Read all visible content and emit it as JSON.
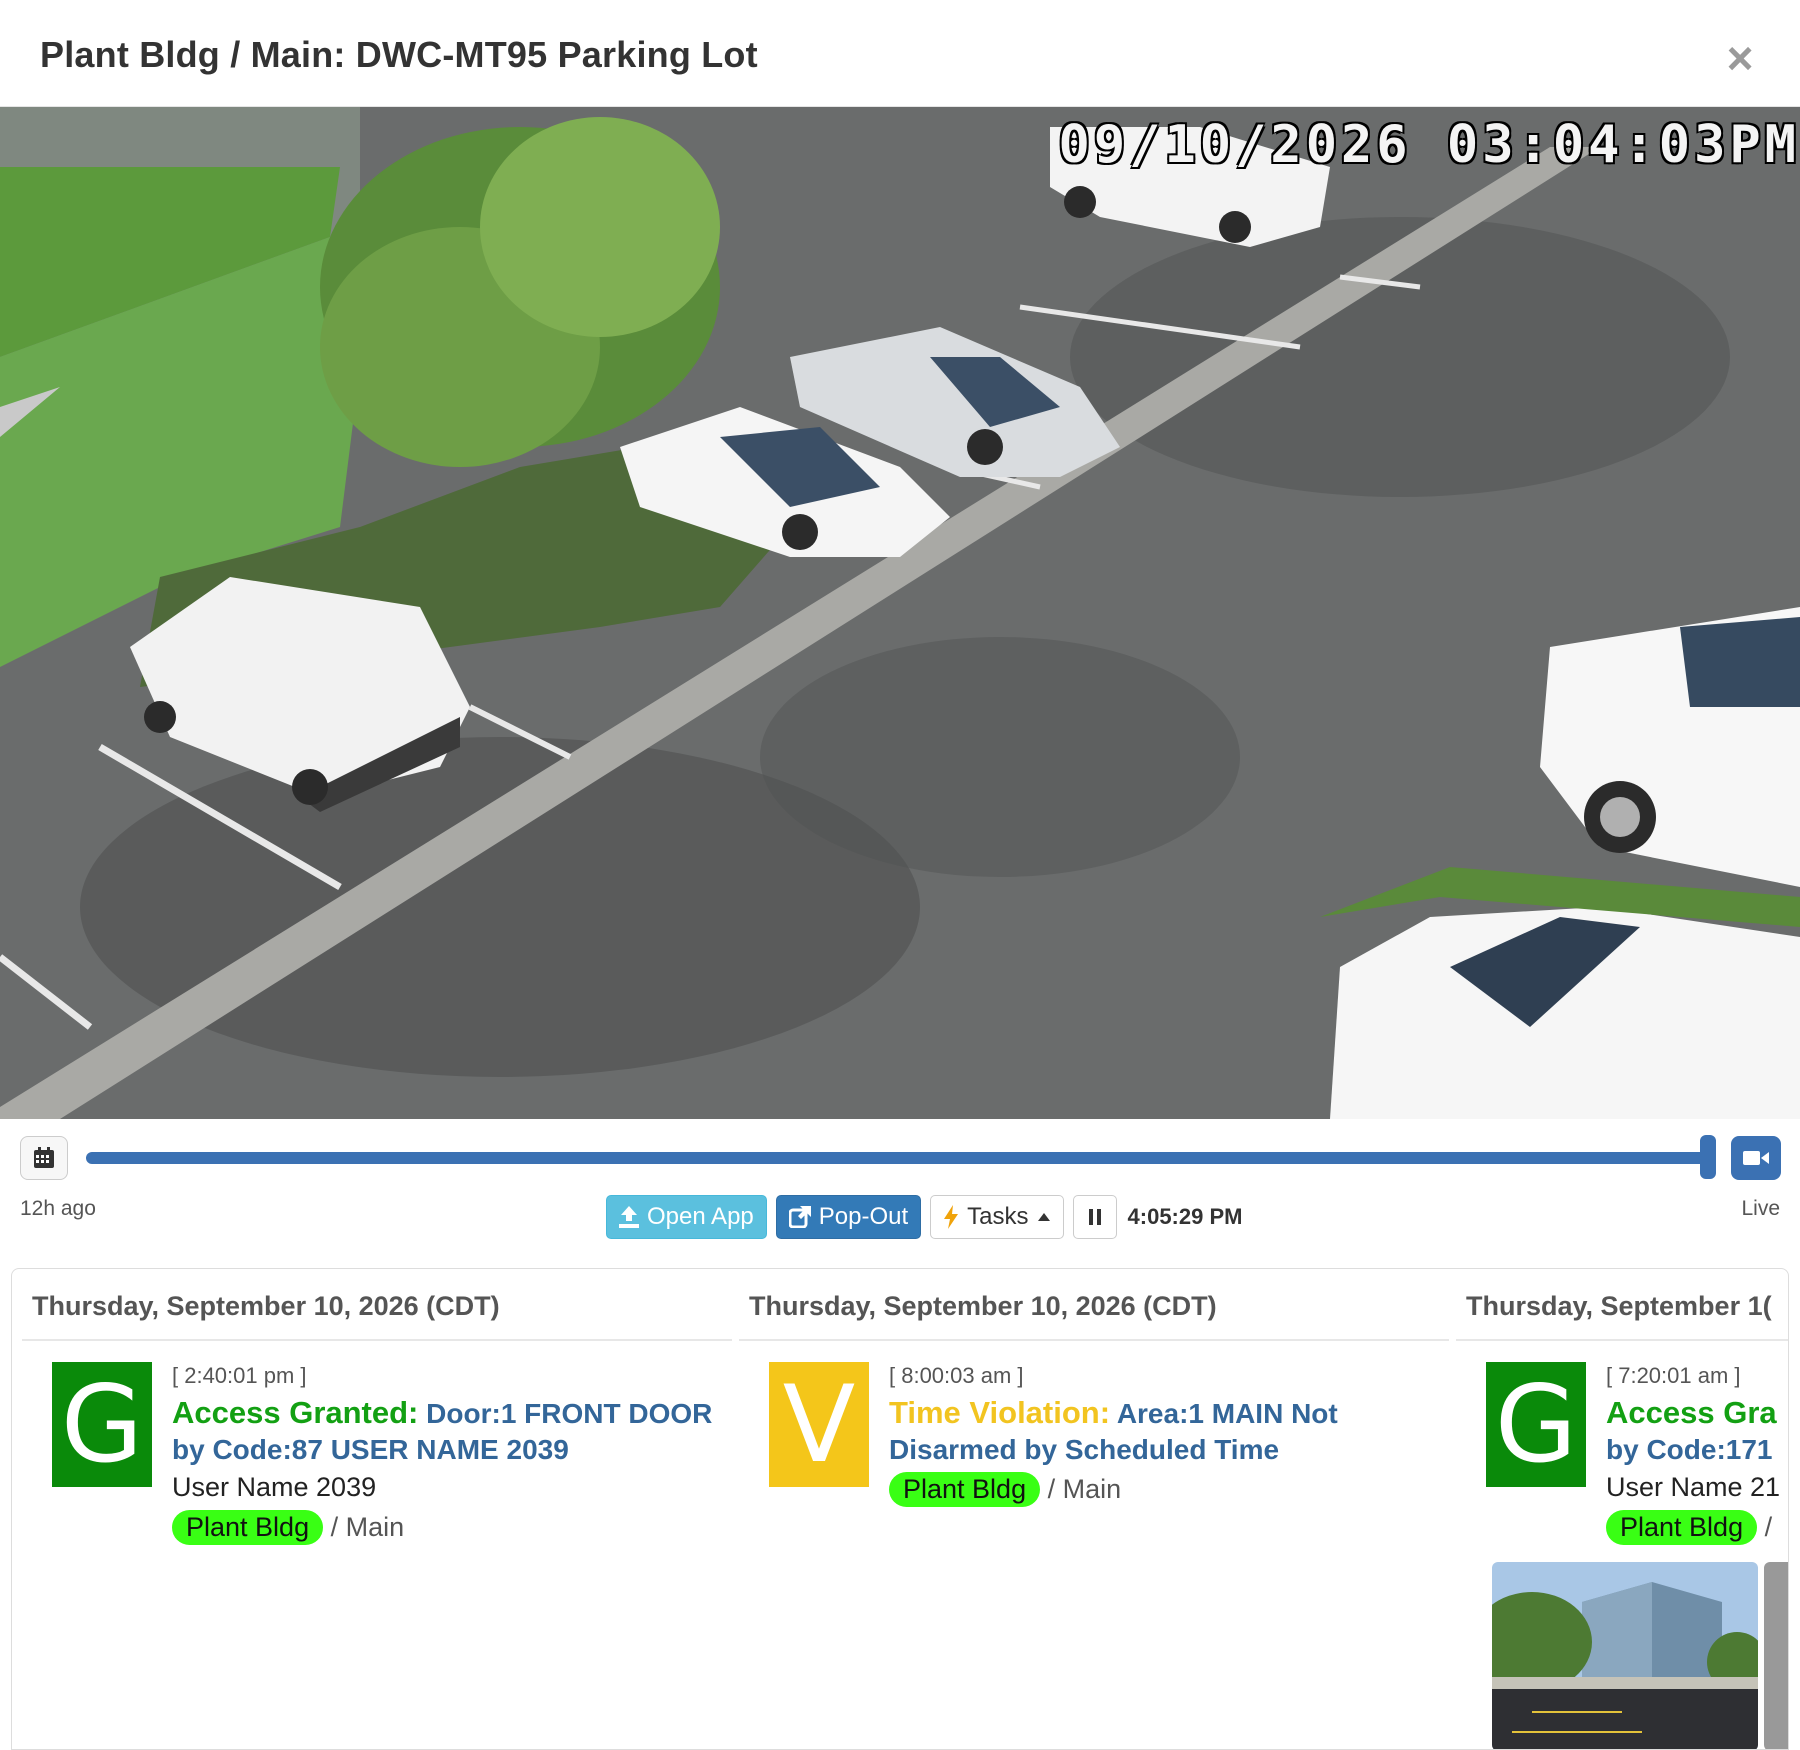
{
  "modal": {
    "title": "Plant Bldg / Main: DWC-MT95 Parking Lot",
    "close_glyph": "×"
  },
  "video": {
    "overlay_timestamp": "09/10/2026 03:04:03PM"
  },
  "timeline": {
    "start_label": "12h ago",
    "end_label": "Live",
    "position_fraction": 1.0,
    "calendar_icon": "calendar-icon",
    "live_icon": "video-camera-icon"
  },
  "toolbar": {
    "open_app": "Open App",
    "pop_out": "Pop-Out",
    "tasks": "Tasks",
    "clock": "4:05:29 PM"
  },
  "events": [
    {
      "day": "Thursday, September 10, 2026 (CDT)",
      "badge": "G",
      "badge_color": "#0a8a0a",
      "time": "[ 2:40:01 pm ]",
      "type": "Access Granted:",
      "detail": "Door:1 FRONT DOOR by Code:87 USER NAME 2039",
      "user": "User Name 2039",
      "site": "Plant Bldg",
      "area": "/ Main"
    },
    {
      "day": "Thursday, September 10, 2026 (CDT)",
      "badge": "V",
      "badge_color": "#f4c61a",
      "time": "[ 8:00:03 am ]",
      "type": "Time Violation:",
      "detail": "Area:1 MAIN Not Disarmed by Scheduled Time",
      "site": "Plant Bldg",
      "area": "/ Main"
    },
    {
      "day": "Thursday, September 1(",
      "badge": "G",
      "badge_color": "#0a8a0a",
      "time": "[ 7:20:01 am ]",
      "type": "Access Gra",
      "detail": "by Code:171",
      "user": "User Name 21",
      "site": "Plant Bldg",
      "area": "/"
    }
  ],
  "colors": {
    "primary": "#337ab7",
    "info": "#5bc0de",
    "timeline": "#3b71b3",
    "granted": "#13a013",
    "violation": "#f2c420",
    "site_pill": "#39ff14"
  }
}
